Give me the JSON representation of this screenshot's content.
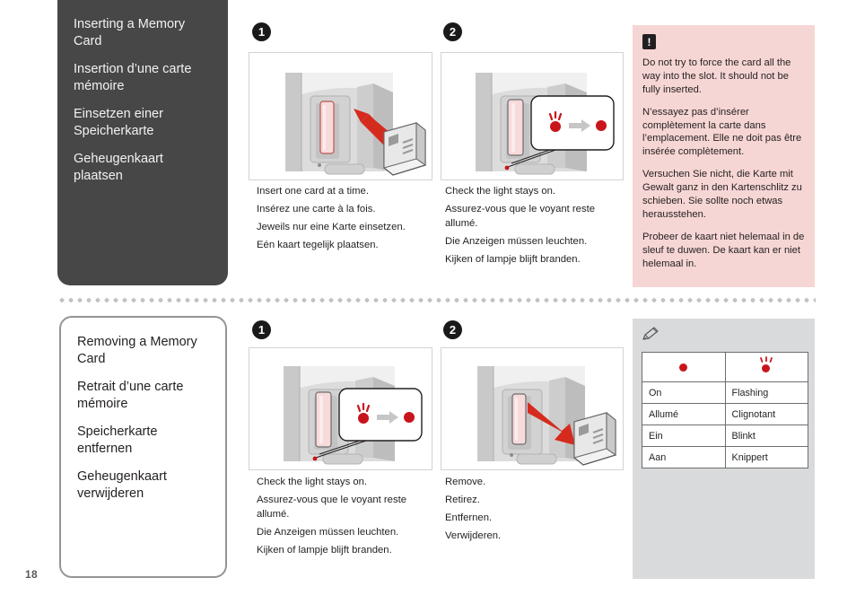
{
  "page": {
    "number": "18"
  },
  "sections": [
    {
      "heading_box": {
        "style": "dark",
        "lines": [
          "Inserting a Memory Card",
          "Insertion d’une carte mémoire",
          "Einsetzen einer Speicherkarte",
          "Geheugenkaart plaatsen"
        ]
      },
      "steps": [
        {
          "badge": "1",
          "illustration": "memory-card-insert",
          "caption": [
            "Insert one card at a time.",
            "Insérez une carte à la fois.",
            "Jeweils nur eine Karte einsetzen.",
            "Eén kaart tegelijk plaatsen."
          ]
        },
        {
          "badge": "2",
          "illustration": "memory-card-light-check",
          "caption": [
            "Check the light stays on.",
            "Assurez-vous que le voyant reste allumé.",
            "Die Anzeigen müssen leuchten.",
            "Kijken of lampje blijft branden."
          ]
        }
      ]
    },
    {
      "heading_box": {
        "style": "light",
        "lines": [
          "Removing a Memory Card",
          "Retrait d’une carte mémoire",
          "Speicherkarte entfernen",
          "Geheugenkaart verwijderen"
        ]
      },
      "steps": [
        {
          "badge": "1",
          "illustration": "memory-card-light-check",
          "caption": [
            "Check the light stays on.",
            "Assurez-vous que le voyant reste allumé.",
            "Die Anzeigen müssen leuchten.",
            "Kijken of lampje blijft branden."
          ]
        },
        {
          "badge": "2",
          "illustration": "memory-card-remove",
          "caption": [
            "Remove.",
            "Retirez.",
            "Entfernen.",
            "Verwijderen."
          ]
        }
      ]
    }
  ],
  "warning": {
    "icon": "exclamation-icon",
    "icon_glyph": "!",
    "background_color": "#f6d6d4",
    "paragraphs": [
      "Do not try to force the card all the way into the slot. It should not be fully inserted.",
      "N’essayez pas d’insérer complètement la carte dans l’emplacement. Elle ne doit pas être insérée complètement.",
      "Versuchen Sie nicht, die Karte mit Gewalt ganz in den Kartenschlitz zu schieben. Sie sollte noch etwas herausstehen.",
      "Probeer de kaart niet helemaal in de sleuf te duwen. De kaart kan er niet helemaal in."
    ]
  },
  "note": {
    "icon": "pencil-icon",
    "background_color": "#d9dadb",
    "table": {
      "symbol_headers": [
        "led-on-icon",
        "led-flashing-icon"
      ],
      "rows": [
        [
          "On",
          "Flashing"
        ],
        [
          "Allumé",
          "Clignotant"
        ],
        [
          "Ein",
          "Blinkt"
        ],
        [
          "Aan",
          "Knippert"
        ]
      ]
    }
  },
  "colors": {
    "led_red": "#c8151b",
    "arrow_red": "#d52b1e",
    "dark_box": "#474747",
    "warning_pink": "#f6d6d4",
    "note_gray": "#d9dadb"
  }
}
